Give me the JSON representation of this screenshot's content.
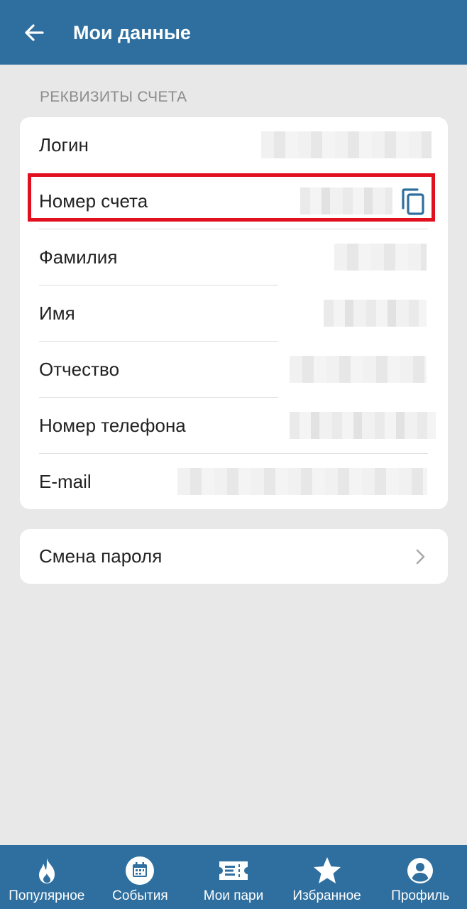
{
  "header": {
    "title": "Мои данные",
    "back_icon": "arrow-left-icon"
  },
  "section": {
    "label": "РЕКВИЗИТЫ СЧЕТА"
  },
  "rows": [
    {
      "label": "Логин"
    },
    {
      "label": "Номер счета"
    },
    {
      "label": "Фамилия"
    },
    {
      "label": "Имя"
    },
    {
      "label": "Отчество"
    },
    {
      "label": "Номер телефона"
    },
    {
      "label": "E-mail"
    }
  ],
  "password": {
    "label": "Смена пароля"
  },
  "tabs": [
    {
      "label": "Популярное",
      "icon": "flame-icon"
    },
    {
      "label": "События",
      "icon": "calendar-icon"
    },
    {
      "label": "Мои пари",
      "icon": "ticket-icon"
    },
    {
      "label": "Избранное",
      "icon": "star-icon"
    },
    {
      "label": "Профиль",
      "icon": "profile-icon"
    }
  ],
  "colors": {
    "primary": "#2f6f9f",
    "background": "#e9e8e9",
    "highlight": "#e0101e",
    "copy_icon": "#2f6f9f"
  }
}
